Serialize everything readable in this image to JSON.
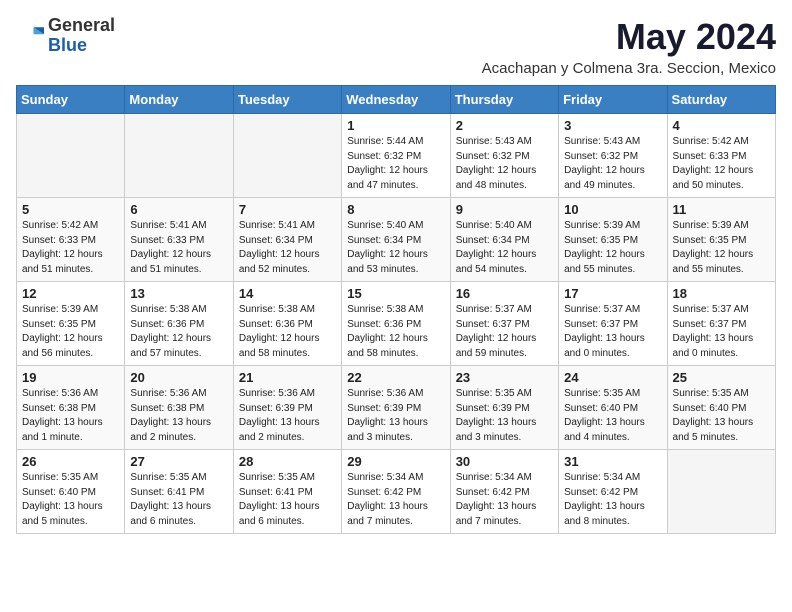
{
  "logo": {
    "general": "General",
    "blue": "Blue"
  },
  "title": "May 2024",
  "subtitle": "Acachapan y Colmena 3ra. Seccion, Mexico",
  "days_of_week": [
    "Sunday",
    "Monday",
    "Tuesday",
    "Wednesday",
    "Thursday",
    "Friday",
    "Saturday"
  ],
  "weeks": [
    [
      {
        "day": "",
        "info": ""
      },
      {
        "day": "",
        "info": ""
      },
      {
        "day": "",
        "info": ""
      },
      {
        "day": "1",
        "info": "Sunrise: 5:44 AM\nSunset: 6:32 PM\nDaylight: 12 hours\nand 47 minutes."
      },
      {
        "day": "2",
        "info": "Sunrise: 5:43 AM\nSunset: 6:32 PM\nDaylight: 12 hours\nand 48 minutes."
      },
      {
        "day": "3",
        "info": "Sunrise: 5:43 AM\nSunset: 6:32 PM\nDaylight: 12 hours\nand 49 minutes."
      },
      {
        "day": "4",
        "info": "Sunrise: 5:42 AM\nSunset: 6:33 PM\nDaylight: 12 hours\nand 50 minutes."
      }
    ],
    [
      {
        "day": "5",
        "info": "Sunrise: 5:42 AM\nSunset: 6:33 PM\nDaylight: 12 hours\nand 51 minutes."
      },
      {
        "day": "6",
        "info": "Sunrise: 5:41 AM\nSunset: 6:33 PM\nDaylight: 12 hours\nand 51 minutes."
      },
      {
        "day": "7",
        "info": "Sunrise: 5:41 AM\nSunset: 6:34 PM\nDaylight: 12 hours\nand 52 minutes."
      },
      {
        "day": "8",
        "info": "Sunrise: 5:40 AM\nSunset: 6:34 PM\nDaylight: 12 hours\nand 53 minutes."
      },
      {
        "day": "9",
        "info": "Sunrise: 5:40 AM\nSunset: 6:34 PM\nDaylight: 12 hours\nand 54 minutes."
      },
      {
        "day": "10",
        "info": "Sunrise: 5:39 AM\nSunset: 6:35 PM\nDaylight: 12 hours\nand 55 minutes."
      },
      {
        "day": "11",
        "info": "Sunrise: 5:39 AM\nSunset: 6:35 PM\nDaylight: 12 hours\nand 55 minutes."
      }
    ],
    [
      {
        "day": "12",
        "info": "Sunrise: 5:39 AM\nSunset: 6:35 PM\nDaylight: 12 hours\nand 56 minutes."
      },
      {
        "day": "13",
        "info": "Sunrise: 5:38 AM\nSunset: 6:36 PM\nDaylight: 12 hours\nand 57 minutes."
      },
      {
        "day": "14",
        "info": "Sunrise: 5:38 AM\nSunset: 6:36 PM\nDaylight: 12 hours\nand 58 minutes."
      },
      {
        "day": "15",
        "info": "Sunrise: 5:38 AM\nSunset: 6:36 PM\nDaylight: 12 hours\nand 58 minutes."
      },
      {
        "day": "16",
        "info": "Sunrise: 5:37 AM\nSunset: 6:37 PM\nDaylight: 12 hours\nand 59 minutes."
      },
      {
        "day": "17",
        "info": "Sunrise: 5:37 AM\nSunset: 6:37 PM\nDaylight: 13 hours\nand 0 minutes."
      },
      {
        "day": "18",
        "info": "Sunrise: 5:37 AM\nSunset: 6:37 PM\nDaylight: 13 hours\nand 0 minutes."
      }
    ],
    [
      {
        "day": "19",
        "info": "Sunrise: 5:36 AM\nSunset: 6:38 PM\nDaylight: 13 hours\nand 1 minute."
      },
      {
        "day": "20",
        "info": "Sunrise: 5:36 AM\nSunset: 6:38 PM\nDaylight: 13 hours\nand 2 minutes."
      },
      {
        "day": "21",
        "info": "Sunrise: 5:36 AM\nSunset: 6:39 PM\nDaylight: 13 hours\nand 2 minutes."
      },
      {
        "day": "22",
        "info": "Sunrise: 5:36 AM\nSunset: 6:39 PM\nDaylight: 13 hours\nand 3 minutes."
      },
      {
        "day": "23",
        "info": "Sunrise: 5:35 AM\nSunset: 6:39 PM\nDaylight: 13 hours\nand 3 minutes."
      },
      {
        "day": "24",
        "info": "Sunrise: 5:35 AM\nSunset: 6:40 PM\nDaylight: 13 hours\nand 4 minutes."
      },
      {
        "day": "25",
        "info": "Sunrise: 5:35 AM\nSunset: 6:40 PM\nDaylight: 13 hours\nand 5 minutes."
      }
    ],
    [
      {
        "day": "26",
        "info": "Sunrise: 5:35 AM\nSunset: 6:40 PM\nDaylight: 13 hours\nand 5 minutes."
      },
      {
        "day": "27",
        "info": "Sunrise: 5:35 AM\nSunset: 6:41 PM\nDaylight: 13 hours\nand 6 minutes."
      },
      {
        "day": "28",
        "info": "Sunrise: 5:35 AM\nSunset: 6:41 PM\nDaylight: 13 hours\nand 6 minutes."
      },
      {
        "day": "29",
        "info": "Sunrise: 5:34 AM\nSunset: 6:42 PM\nDaylight: 13 hours\nand 7 minutes."
      },
      {
        "day": "30",
        "info": "Sunrise: 5:34 AM\nSunset: 6:42 PM\nDaylight: 13 hours\nand 7 minutes."
      },
      {
        "day": "31",
        "info": "Sunrise: 5:34 AM\nSunset: 6:42 PM\nDaylight: 13 hours\nand 8 minutes."
      },
      {
        "day": "",
        "info": ""
      }
    ]
  ]
}
